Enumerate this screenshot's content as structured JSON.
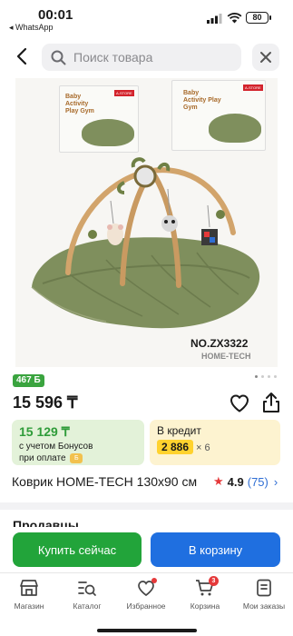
{
  "status_bar": {
    "time": "00:01",
    "back_app": "◂ WhatsApp",
    "battery": "80"
  },
  "search": {
    "placeholder": "Поиск товара"
  },
  "product_image": {
    "model": "NO.ZX3322",
    "brand": "HOME-TECH",
    "box_title": "Baby Activity Play Gym",
    "sticker": "A-STORE",
    "image_count": 4,
    "active_image": 1
  },
  "bonus_badge": "467 Б",
  "price": "15 596 ₸",
  "bonus_card": {
    "amount": "15 129 ₸",
    "line1": "с учетом Бонусов",
    "line2": "при оплате",
    "coin": "Б"
  },
  "credit_card": {
    "title": "В кредит",
    "installment": "2 886",
    "multiplier": "× 6"
  },
  "product_title": "Коврик HOME-TECH 130x90 см",
  "rating": {
    "value": "4.9",
    "count": "(75)"
  },
  "sellers_heading": "Продавцы",
  "actions": {
    "buy_now": "Купить сейчас",
    "add_to_cart": "В корзину"
  },
  "tabbar": {
    "items": [
      {
        "label": "Магазин",
        "icon": "shop-icon"
      },
      {
        "label": "Каталог",
        "icon": "catalog-icon"
      },
      {
        "label": "Избранное",
        "icon": "heart-icon"
      },
      {
        "label": "Корзина",
        "icon": "cart-icon",
        "badge": "3"
      },
      {
        "label": "Мои заказы",
        "icon": "orders-icon"
      }
    ]
  },
  "colors": {
    "green": "#22a43a",
    "blue": "#1f6fe0",
    "red": "#e5393a",
    "yellow": "#ffd22e",
    "mat": "#7f8f5d"
  }
}
